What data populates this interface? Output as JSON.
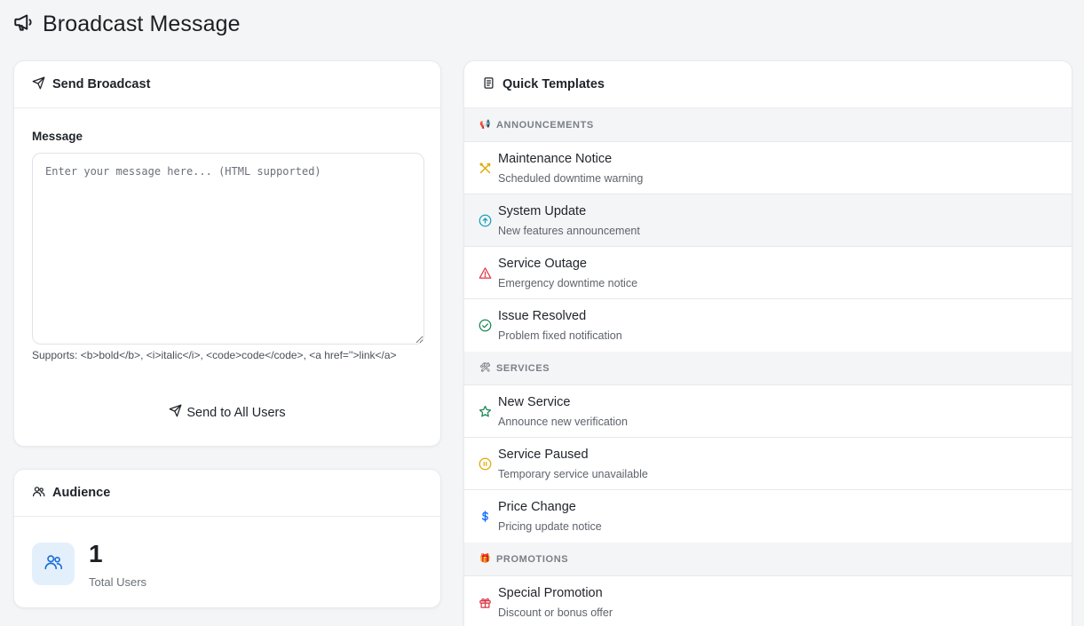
{
  "page": {
    "title": "Broadcast Message"
  },
  "send_card": {
    "header": "Send Broadcast",
    "message_label": "Message",
    "message_placeholder": "Enter your message here... (HTML supported)",
    "message_value": "",
    "supports_text": "Supports: <b>bold</b>, <i>italic</i>, <code>code</code>, <a href=''>link</a>",
    "send_button": "Send to All Users"
  },
  "audience_card": {
    "header": "Audience",
    "count": "1",
    "count_label": "Total Users"
  },
  "templates_card": {
    "header": "Quick Templates",
    "sections": [
      {
        "title": "ANNOUNCEMENTS",
        "emoji": "📢",
        "items": [
          {
            "title": "Maintenance Notice",
            "desc": "Scheduled downtime warning",
            "icon": "tools-icon",
            "color": "#e0a800"
          },
          {
            "title": "System Update",
            "desc": "New features announcement",
            "icon": "arrow-up-circle-icon",
            "color": "#17a2b8"
          },
          {
            "title": "Service Outage",
            "desc": "Emergency downtime notice",
            "icon": "warning-triangle-icon",
            "color": "#dc3545"
          },
          {
            "title": "Issue Resolved",
            "desc": "Problem fixed notification",
            "icon": "check-circle-icon",
            "color": "#198754"
          }
        ]
      },
      {
        "title": "SERVICES",
        "emoji": "🛠",
        "items": [
          {
            "title": "New Service",
            "desc": "Announce new verification",
            "icon": "star-icon",
            "color": "#198754"
          },
          {
            "title": "Service Paused",
            "desc": "Temporary service unavailable",
            "icon": "pause-circle-icon",
            "color": "#e0a800"
          },
          {
            "title": "Price Change",
            "desc": "Pricing update notice",
            "icon": "dollar-icon",
            "color": "#0d6efd"
          }
        ]
      },
      {
        "title": "PROMOTIONS",
        "emoji": "🎁",
        "items": [
          {
            "title": "Special Promotion",
            "desc": "Discount or bonus offer",
            "icon": "gift-icon",
            "color": "#dc3545"
          }
        ]
      }
    ]
  }
}
